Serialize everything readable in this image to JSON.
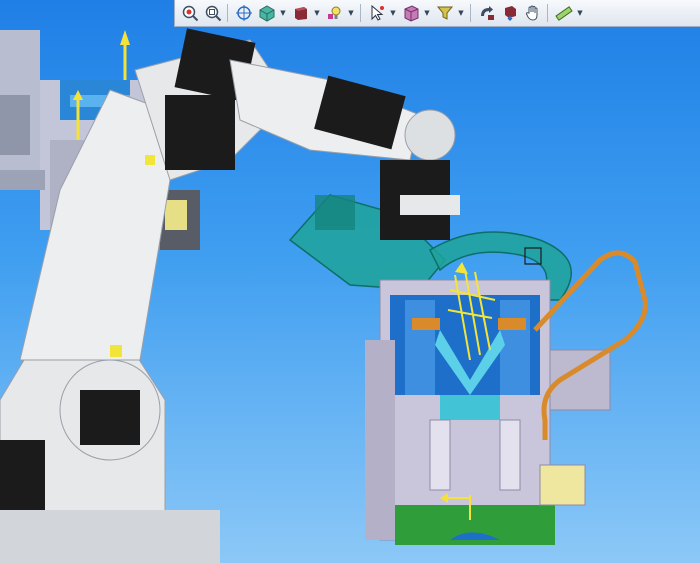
{
  "app": {
    "view": "3d-robot-simulation-viewport"
  },
  "colors": {
    "sky_top": "#1f7fe6",
    "sky_bottom": "#8cc8f7",
    "robot_body": "#e6e8ea",
    "robot_dark": "#1b1b1b",
    "gripper_ghost": "#1fa39a",
    "fixture_blue": "#1d6fc9",
    "fixture_base": "#c9c6dc",
    "base_green": "#2f9e3a",
    "hose_orange": "#d98a2b",
    "frame_yellow": "#f1e53a"
  },
  "toolbar": {
    "icons": [
      "zoom-area-icon",
      "zoom-fit-icon",
      "view-target-icon",
      "view-orientation-icon",
      "display-style-icon",
      "lighting-icon",
      "select-pointer-icon",
      "section-box-icon",
      "filter-icon",
      "part-transform-icon",
      "rotate-icon",
      "hand-pan-icon",
      "measure-icon"
    ]
  }
}
